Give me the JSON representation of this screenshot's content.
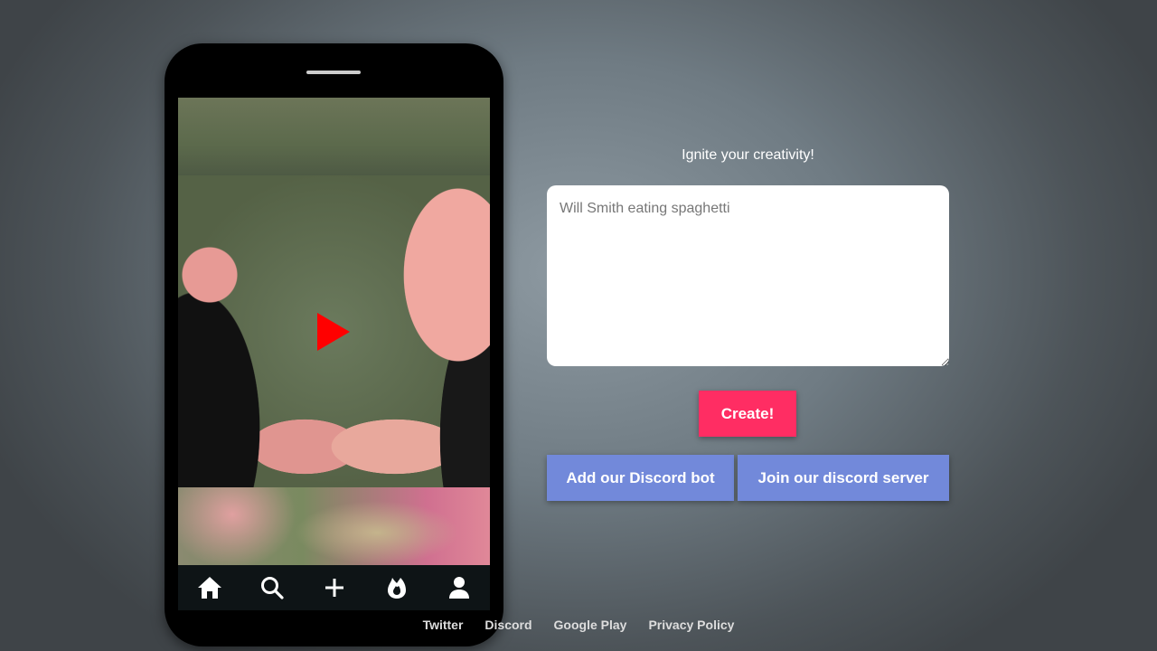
{
  "tagline": "Ignite your creativity!",
  "prompt": {
    "placeholder": "Will Smith eating spaghetti"
  },
  "buttons": {
    "create": "Create!",
    "discord_bot": "Add our Discord bot",
    "discord_server": "Join our discord server"
  },
  "phone_nav": [
    "home-icon",
    "search-icon",
    "plus-icon",
    "fire-icon",
    "user-icon"
  ],
  "footer": [
    "Twitter",
    "Discord",
    "Google Play",
    "Privacy Policy"
  ],
  "colors": {
    "create": "#ff2d63",
    "discord": "#7289da",
    "play": "#ff0000"
  }
}
